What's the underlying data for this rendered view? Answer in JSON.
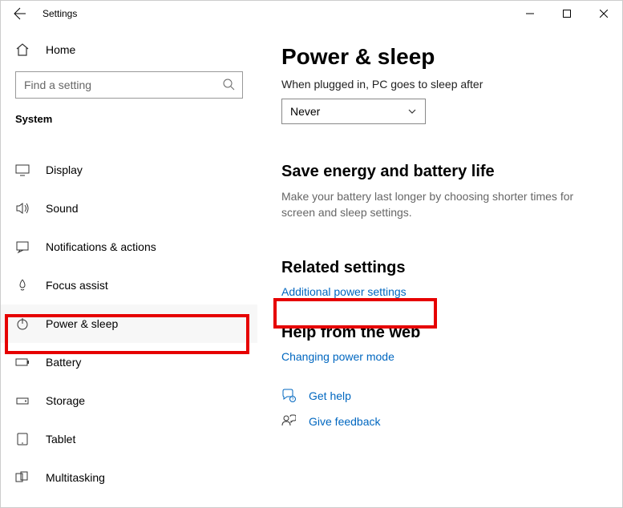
{
  "titlebar": {
    "title": "Settings"
  },
  "sidebar": {
    "home_label": "Home",
    "search_placeholder": "Find a setting",
    "section_label": "System",
    "items": [
      {
        "label": "Display"
      },
      {
        "label": "Sound"
      },
      {
        "label": "Notifications & actions"
      },
      {
        "label": "Focus assist"
      },
      {
        "label": "Power & sleep"
      },
      {
        "label": "Battery"
      },
      {
        "label": "Storage"
      },
      {
        "label": "Tablet"
      },
      {
        "label": "Multitasking"
      }
    ]
  },
  "main": {
    "title": "Power & sleep",
    "sleep_label": "When plugged in, PC goes to sleep after",
    "sleep_value": "Never",
    "energy_heading": "Save energy and battery life",
    "energy_text": "Make your battery last longer by choosing shorter times for screen and sleep settings.",
    "related_heading": "Related settings",
    "related_link": "Additional power settings",
    "help_heading": "Help from the web",
    "help_link": "Changing power mode",
    "get_help": "Get help",
    "give_feedback": "Give feedback"
  }
}
